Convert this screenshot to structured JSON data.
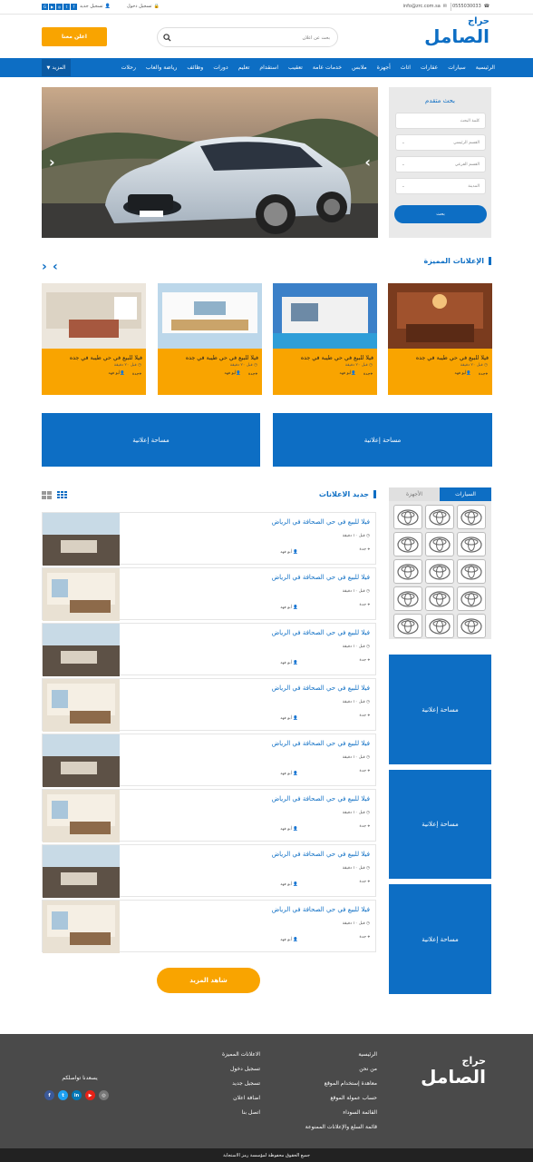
{
  "topbar": {
    "phone": "0555030033",
    "email": "info@zrc.com.sa",
    "login": "تسجيل دخول",
    "register": "تسجيل جديد"
  },
  "logo": {
    "top": "حراج",
    "main": "الصامل"
  },
  "search": {
    "placeholder": "بحث عن اعلان"
  },
  "header": {
    "ad_button": "اعلن معنا"
  },
  "nav": {
    "items": [
      "الرئيسية",
      "سيارات",
      "عقارات",
      "اثاث",
      "أجهزة",
      "ملابس",
      "خدمات عامة",
      "تعقيب",
      "استقدام",
      "تعليم",
      "دورات",
      "وظائف",
      "رياضة والعاب",
      "رحلات"
    ],
    "more": "المزيد"
  },
  "side_search": {
    "title": "بحث متقدم",
    "keyword": "كلمة البحث",
    "main_cat": "القسم الرئيسي",
    "sub_cat": "القسم الفرعي",
    "city": "المدينة",
    "button": "بحث"
  },
  "featured": {
    "title": "الإعلانات المميزة",
    "cards": [
      {
        "title": "فيلا للبيع في حي طيبة في جده",
        "time": "قبل ٢٠ دقيقة",
        "city": "جدة",
        "user": "أبو فهد"
      },
      {
        "title": "فيلا للبيع في حي طيبة في جده",
        "time": "قبل ٢٠ دقيقة",
        "city": "جدة",
        "user": "أبو فهد"
      },
      {
        "title": "فيلا للبيع في حي طيبة في جده",
        "time": "قبل ٢٠ دقيقة",
        "city": "جدة",
        "user": "أبو فهد"
      },
      {
        "title": "فيلا للبيع في حي طيبة في جده",
        "time": "قبل ٢٠ دقيقة",
        "city": "جدة",
        "user": "أبو فهد"
      }
    ]
  },
  "ad_space": "مساحة إعلانية",
  "latest": {
    "title": "جديد الاعلانات",
    "rows": [
      {
        "title": "فيلا للبيع في حي الصحافة في الرياض",
        "time": "قبل ١٠ دقيقة",
        "city": "جدة",
        "user": "أبو فهد"
      },
      {
        "title": "فيلا للبيع في حي الصحافة في الرياض",
        "time": "قبل ١٠ دقيقة",
        "city": "جدة",
        "user": "أبو فهد"
      },
      {
        "title": "فيلا للبيع في حي الصحافة في الرياض",
        "time": "قبل ١٠ دقيقة",
        "city": "جدة",
        "user": "أبو فهد"
      },
      {
        "title": "فيلا للبيع في حي الصحافة في الرياض",
        "time": "قبل ١٠ دقيقة",
        "city": "جدة",
        "user": "أبو فهد"
      },
      {
        "title": "فيلا للبيع في حي الصحافة في الرياض",
        "time": "قبل ١٠ دقيقة",
        "city": "جدة",
        "user": "أبو فهد"
      },
      {
        "title": "فيلا للبيع في حي الصحافة في الرياض",
        "time": "قبل ١٠ دقيقة",
        "city": "جدة",
        "user": "أبو فهد"
      },
      {
        "title": "فيلا للبيع في حي الصحافة في الرياض",
        "time": "قبل ١٠ دقيقة",
        "city": "جدة",
        "user": "أبو فهد"
      },
      {
        "title": "فيلا للبيع في حي الصحافة في الرياض",
        "time": "قبل ١٠ دقيقة",
        "city": "جدة",
        "user": "أبو فهد"
      }
    ],
    "more_button": "شاهد المزيد"
  },
  "brand_tabs": {
    "active": "السيارات",
    "inactive": "الأجهزة"
  },
  "footer": {
    "col1": [
      "الرئيسية",
      "من نحن",
      "معاهدة إستخدام الموقع",
      "حساب عمولة الموقع",
      "القائمة السوداء",
      "قائمة السلع والإعلانات الممنوعة"
    ],
    "col2": [
      "الاعلانات المميزة",
      "تسجيل دخول",
      "تسجيل جديد",
      "اضافة اعلان",
      "اتصل بنا"
    ],
    "contact": "يسعدنا تواصلكم",
    "copyright": "جميع الحقوق محفوظة لمؤسسة رمز الاستجابة"
  },
  "colors": {
    "primary": "#0d6ec4",
    "accent": "#f9a400",
    "footer": "#4a4a4a"
  }
}
